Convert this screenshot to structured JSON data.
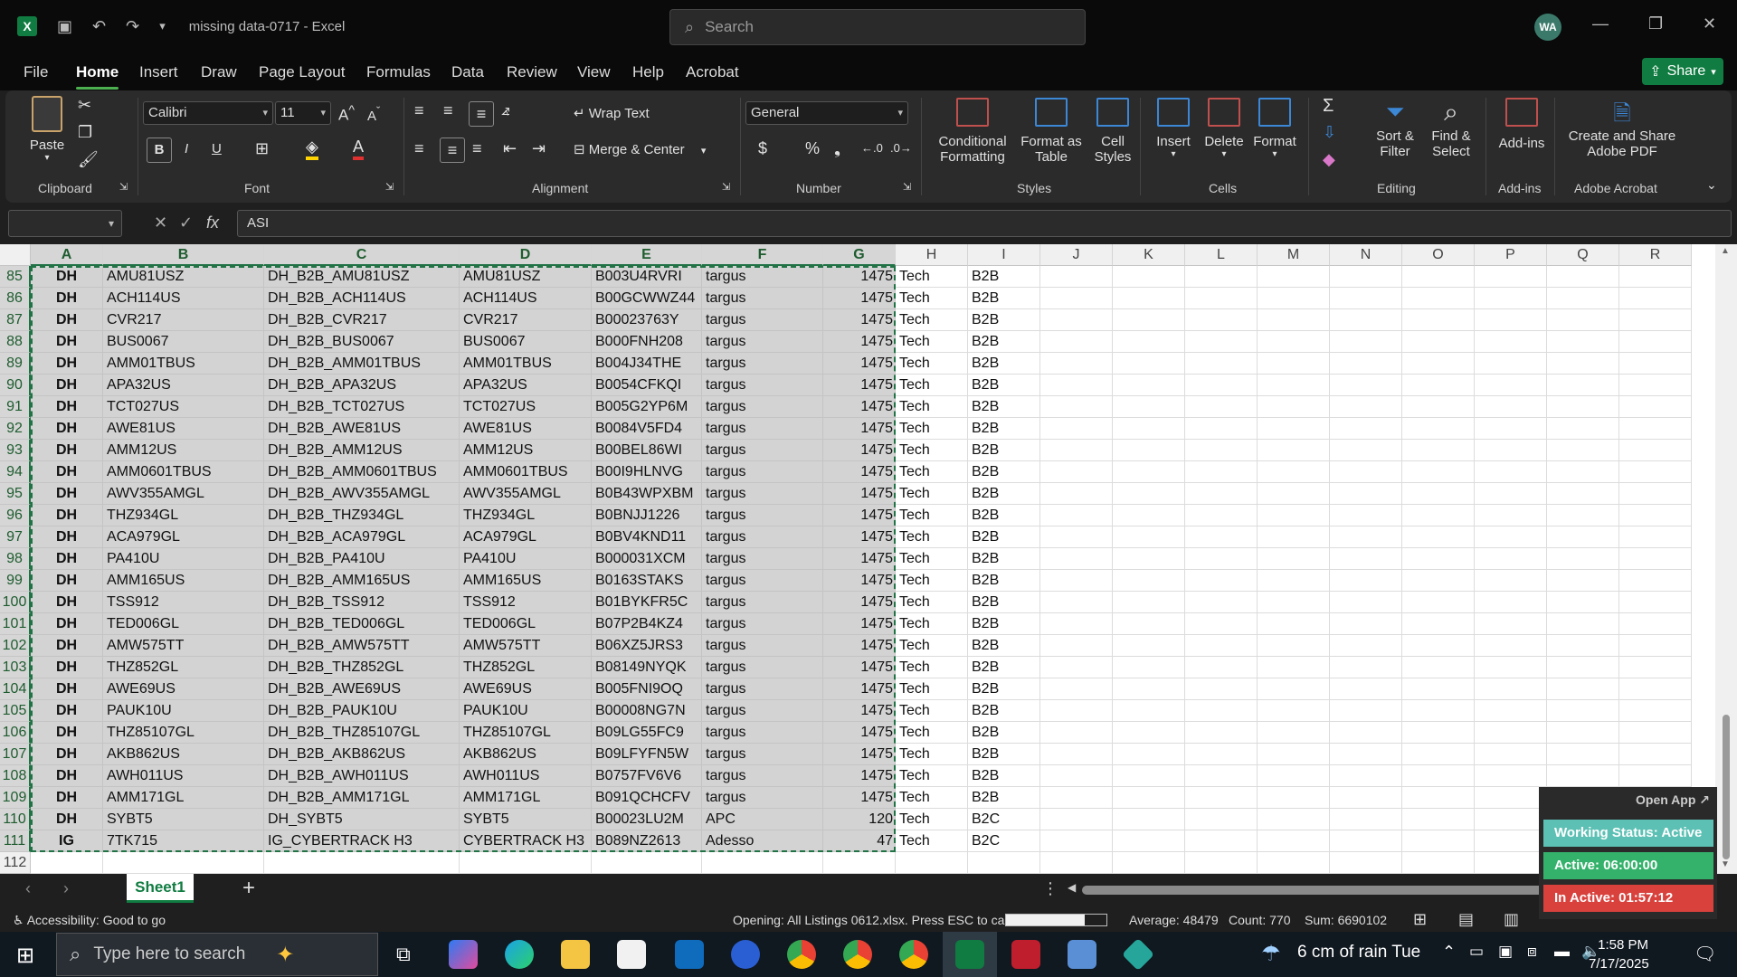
{
  "app": {
    "title": "missing data-0717  -  Excel",
    "search_placeholder": "Search",
    "user_initials": "WA",
    "share_label": "Share"
  },
  "menu": [
    "File",
    "Home",
    "Insert",
    "Draw",
    "Page Layout",
    "Formulas",
    "Data",
    "Review",
    "View",
    "Help",
    "Acrobat"
  ],
  "ribbon": {
    "paste": "Paste",
    "font_name": "Calibri",
    "font_size": "11",
    "wrap_text": "Wrap Text",
    "merge_center": "Merge & Center",
    "number_format": "General",
    "conditional_formatting": [
      "Conditional",
      "Formatting"
    ],
    "format_as_table": [
      "Format as",
      "Table"
    ],
    "cell_styles": [
      "Cell",
      "Styles"
    ],
    "insert": "Insert",
    "delete": "Delete",
    "format": "Format",
    "sort_filter": [
      "Sort &",
      "Filter"
    ],
    "find_select": [
      "Find &",
      "Select"
    ],
    "add_ins": "Add-ins",
    "create_pdf": [
      "Create and Share",
      "Adobe PDF"
    ],
    "groups": {
      "clipboard": "Clipboard",
      "font": "Font",
      "alignment": "Alignment",
      "number": "Number",
      "styles": "Styles",
      "cells": "Cells",
      "editing": "Editing",
      "addins": "Add-ins",
      "acrobat": "Adobe Acrobat"
    }
  },
  "formula_bar": {
    "name_box": "",
    "value": "ASI"
  },
  "columns": [
    "A",
    "B",
    "C",
    "D",
    "E",
    "F",
    "G",
    "H",
    "I",
    "J",
    "K",
    "L",
    "M",
    "N",
    "O",
    "P",
    "Q",
    "R"
  ],
  "rows": [
    {
      "n": "85",
      "a": "DH",
      "b": "AMU81USZ",
      "c": "DH_B2B_AMU81USZ",
      "d": "AMU81USZ",
      "e": "B003U4RVRI",
      "f": "targus",
      "g": "1475",
      "h": "Tech",
      "i": "B2B"
    },
    {
      "n": "86",
      "a": "DH",
      "b": "ACH114US",
      "c": "DH_B2B_ACH114US",
      "d": "ACH114US",
      "e": "B00GCWWZ44",
      "f": "targus",
      "g": "1475",
      "h": "Tech",
      "i": "B2B"
    },
    {
      "n": "87",
      "a": "DH",
      "b": "CVR217",
      "c": "DH_B2B_CVR217",
      "d": "CVR217",
      "e": "B00023763Y",
      "f": "targus",
      "g": "1475",
      "h": "Tech",
      "i": "B2B"
    },
    {
      "n": "88",
      "a": "DH",
      "b": "BUS0067",
      "c": "DH_B2B_BUS0067",
      "d": "BUS0067",
      "e": "B000FNH208",
      "f": "targus",
      "g": "1475",
      "h": "Tech",
      "i": "B2B"
    },
    {
      "n": "89",
      "a": "DH",
      "b": "AMM01TBUS",
      "c": "DH_B2B_AMM01TBUS",
      "d": "AMM01TBUS",
      "e": "B004J34THE",
      "f": "targus",
      "g": "1475",
      "h": "Tech",
      "i": "B2B"
    },
    {
      "n": "90",
      "a": "DH",
      "b": "APA32US",
      "c": "DH_B2B_APA32US",
      "d": "APA32US",
      "e": "B0054CFKQI",
      "f": "targus",
      "g": "1475",
      "h": "Tech",
      "i": "B2B"
    },
    {
      "n": "91",
      "a": "DH",
      "b": "TCT027US",
      "c": "DH_B2B_TCT027US",
      "d": "TCT027US",
      "e": "B005G2YP6M",
      "f": "targus",
      "g": "1475",
      "h": "Tech",
      "i": "B2B"
    },
    {
      "n": "92",
      "a": "DH",
      "b": "AWE81US",
      "c": "DH_B2B_AWE81US",
      "d": "AWE81US",
      "e": "B0084V5FD4",
      "f": "targus",
      "g": "1475",
      "h": "Tech",
      "i": "B2B"
    },
    {
      "n": "93",
      "a": "DH",
      "b": "AMM12US",
      "c": "DH_B2B_AMM12US",
      "d": "AMM12US",
      "e": "B00BEL86WI",
      "f": "targus",
      "g": "1475",
      "h": "Tech",
      "i": "B2B"
    },
    {
      "n": "94",
      "a": "DH",
      "b": "AMM0601TBUS",
      "c": "DH_B2B_AMM0601TBUS",
      "d": "AMM0601TBUS",
      "e": "B00I9HLNVG",
      "f": "targus",
      "g": "1475",
      "h": "Tech",
      "i": "B2B"
    },
    {
      "n": "95",
      "a": "DH",
      "b": "AWV355AMGL",
      "c": "DH_B2B_AWV355AMGL",
      "d": "AWV355AMGL",
      "e": "B0B43WPXBM",
      "f": "targus",
      "g": "1475",
      "h": "Tech",
      "i": "B2B"
    },
    {
      "n": "96",
      "a": "DH",
      "b": "THZ934GL",
      "c": "DH_B2B_THZ934GL",
      "d": "THZ934GL",
      "e": "B0BNJJ1226",
      "f": "targus",
      "g": "1475",
      "h": "Tech",
      "i": "B2B"
    },
    {
      "n": "97",
      "a": "DH",
      "b": "ACA979GL",
      "c": "DH_B2B_ACA979GL",
      "d": "ACA979GL",
      "e": "B0BV4KND11",
      "f": "targus",
      "g": "1475",
      "h": "Tech",
      "i": "B2B"
    },
    {
      "n": "98",
      "a": "DH",
      "b": "PA410U",
      "c": "DH_B2B_PA410U",
      "d": "PA410U",
      "e": "B000031XCM",
      "f": "targus",
      "g": "1475",
      "h": "Tech",
      "i": "B2B"
    },
    {
      "n": "99",
      "a": "DH",
      "b": "AMM165US",
      "c": "DH_B2B_AMM165US",
      "d": "AMM165US",
      "e": "B0163STAKS",
      "f": "targus",
      "g": "1475",
      "h": "Tech",
      "i": "B2B"
    },
    {
      "n": "100",
      "a": "DH",
      "b": "TSS912",
      "c": "DH_B2B_TSS912",
      "d": "TSS912",
      "e": "B01BYKFR5C",
      "f": "targus",
      "g": "1475",
      "h": "Tech",
      "i": "B2B"
    },
    {
      "n": "101",
      "a": "DH",
      "b": "TED006GL",
      "c": "DH_B2B_TED006GL",
      "d": "TED006GL",
      "e": "B07P2B4KZ4",
      "f": "targus",
      "g": "1475",
      "h": "Tech",
      "i": "B2B"
    },
    {
      "n": "102",
      "a": "DH",
      "b": "AMW575TT",
      "c": "DH_B2B_AMW575TT",
      "d": "AMW575TT",
      "e": "B06XZ5JRS3",
      "f": "targus",
      "g": "1475",
      "h": "Tech",
      "i": "B2B"
    },
    {
      "n": "103",
      "a": "DH",
      "b": "THZ852GL",
      "c": "DH_B2B_THZ852GL",
      "d": "THZ852GL",
      "e": "B08149NYQK",
      "f": "targus",
      "g": "1475",
      "h": "Tech",
      "i": "B2B"
    },
    {
      "n": "104",
      "a": "DH",
      "b": "AWE69US",
      "c": "DH_B2B_AWE69US",
      "d": "AWE69US",
      "e": "B005FNI9OQ",
      "f": "targus",
      "g": "1475",
      "h": "Tech",
      "i": "B2B"
    },
    {
      "n": "105",
      "a": "DH",
      "b": "PAUK10U",
      "c": "DH_B2B_PAUK10U",
      "d": "PAUK10U",
      "e": "B00008NG7N",
      "f": "targus",
      "g": "1475",
      "h": "Tech",
      "i": "B2B"
    },
    {
      "n": "106",
      "a": "DH",
      "b": "THZ85107GL",
      "c": "DH_B2B_THZ85107GL",
      "d": "THZ85107GL",
      "e": "B09LG55FC9",
      "f": "targus",
      "g": "1475",
      "h": "Tech",
      "i": "B2B"
    },
    {
      "n": "107",
      "a": "DH",
      "b": "AKB862US",
      "c": "DH_B2B_AKB862US",
      "d": "AKB862US",
      "e": "B09LFYFN5W",
      "f": "targus",
      "g": "1475",
      "h": "Tech",
      "i": "B2B"
    },
    {
      "n": "108",
      "a": "DH",
      "b": "AWH011US",
      "c": "DH_B2B_AWH011US",
      "d": "AWH011US",
      "e": "B0757FV6V6",
      "f": "targus",
      "g": "1475",
      "h": "Tech",
      "i": "B2B"
    },
    {
      "n": "109",
      "a": "DH",
      "b": "AMM171GL",
      "c": "DH_B2B_AMM171GL",
      "d": "AMM171GL",
      "e": "B091QCHCFV",
      "f": "targus",
      "g": "1475",
      "h": "Tech",
      "i": "B2B"
    },
    {
      "n": "110",
      "a": "DH",
      "b": "SYBT5",
      "c": "DH_SYBT5",
      "d": "SYBT5",
      "e": "B00023LU2M",
      "f": "APC",
      "g": "120",
      "h": "Tech",
      "i": "B2C"
    },
    {
      "n": "111",
      "a": "IG",
      "b": "7TK715",
      "c": "IG_CYBERTRACK H3",
      "d": "CYBERTRACK H3",
      "e": "B089NZ2613",
      "f": "Adesso",
      "g": "47",
      "h": "Tech",
      "i": "B2C"
    },
    {
      "n": "112",
      "a": "",
      "b": "",
      "c": "",
      "d": "",
      "e": "",
      "f": "",
      "g": "",
      "h": "",
      "i": ""
    }
  ],
  "sheet_tab": "Sheet1",
  "status": {
    "accessibility": "Accessibility: Good to go",
    "message": "Opening: All Listings 0612.xlsx. Press ESC to cancel.",
    "progress": 0.78,
    "average": "Average: 48479",
    "count": "Count: 770",
    "sum": "Sum: 6690102"
  },
  "tracker": {
    "open_app": "Open App ↗",
    "working_status": "Working Status: Active",
    "active": "Active: 06:00:00",
    "inactive": "In Active: 01:57:12"
  },
  "taskbar": {
    "search_placeholder": "Type here to search",
    "weather": "6 cm of rain Tue",
    "time": "1:58 PM",
    "date": "7/17/2025"
  },
  "colors": {
    "excel_green": "#107c41",
    "selection_gray": "#d3d3d3",
    "tracker_teal": "#5cc0b4",
    "tracker_green": "#34b26b",
    "tracker_red": "#d9413d"
  }
}
